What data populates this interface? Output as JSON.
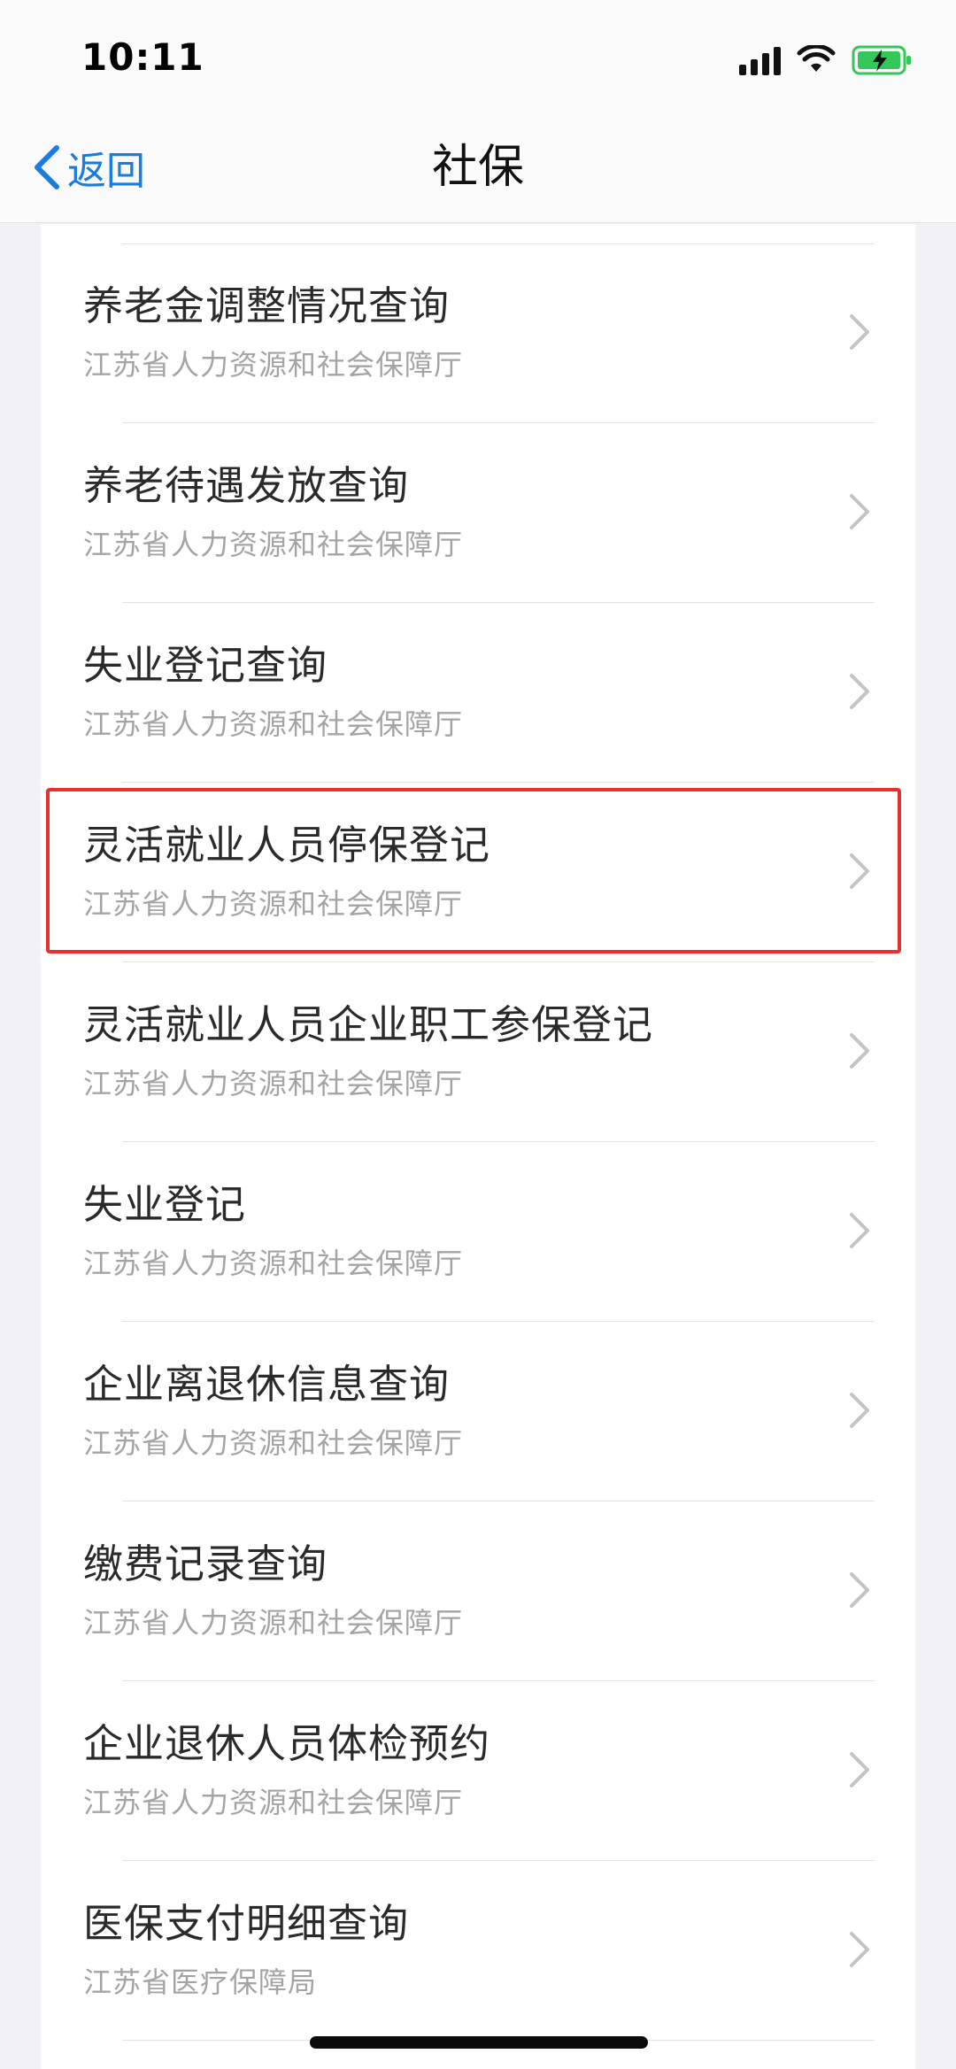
{
  "status_bar": {
    "time": "10:11"
  },
  "nav": {
    "back_label": "返回",
    "title": "社保"
  },
  "list": {
    "items": [
      {
        "title": "养老金调整情况查询",
        "subtitle": "江苏省人力资源和社会保障厅"
      },
      {
        "title": "养老待遇发放查询",
        "subtitle": "江苏省人力资源和社会保障厅"
      },
      {
        "title": "失业登记查询",
        "subtitle": "江苏省人力资源和社会保障厅"
      },
      {
        "title": "灵活就业人员停保登记",
        "subtitle": "江苏省人力资源和社会保障厅",
        "highlighted": true
      },
      {
        "title": "灵活就业人员企业职工参保登记",
        "subtitle": "江苏省人力资源和社会保障厅"
      },
      {
        "title": "失业登记",
        "subtitle": "江苏省人力资源和社会保障厅"
      },
      {
        "title": "企业离退休信息查询",
        "subtitle": "江苏省人力资源和社会保障厅"
      },
      {
        "title": "缴费记录查询",
        "subtitle": "江苏省人力资源和社会保障厅"
      },
      {
        "title": "企业退休人员体检预约",
        "subtitle": "江苏省人力资源和社会保障厅"
      },
      {
        "title": "医保支付明细查询",
        "subtitle": "江苏省医疗保障局"
      }
    ]
  },
  "colors": {
    "accent": "#1a7be0",
    "highlight": "#e8312f",
    "battery": "#34c759"
  },
  "icons": [
    "signal-icon",
    "wifi-icon",
    "battery-charging-icon",
    "back-chevron-icon",
    "chevron-right-icon"
  ]
}
